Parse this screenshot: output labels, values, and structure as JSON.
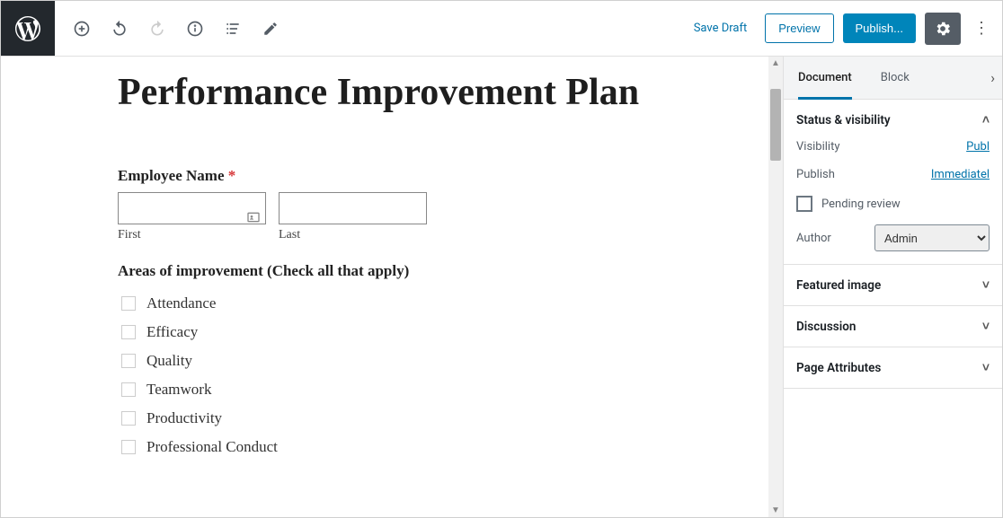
{
  "header": {
    "save_draft": "Save Draft",
    "preview": "Preview",
    "publish": "Publish..."
  },
  "editor": {
    "title": "Performance Improvement Plan",
    "employee_name_label": "Employee Name",
    "first_label": "First",
    "last_label": "Last",
    "areas_label": "Areas of improvement (Check all that apply)",
    "areas": [
      "Attendance",
      "Efficacy",
      "Quality",
      "Teamwork",
      "Productivity",
      "Professional Conduct"
    ]
  },
  "sidebar": {
    "tabs": {
      "document": "Document",
      "block": "Block"
    },
    "status_visibility": "Status & visibility",
    "visibility_label": "Visibility",
    "visibility_value": "Publ",
    "publish_label": "Publish",
    "publish_value": "Immediatel",
    "pending_review": "Pending review",
    "author_label": "Author",
    "author_value": "Admin",
    "featured_image": "Featured image",
    "discussion": "Discussion",
    "page_attributes": "Page Attributes"
  }
}
